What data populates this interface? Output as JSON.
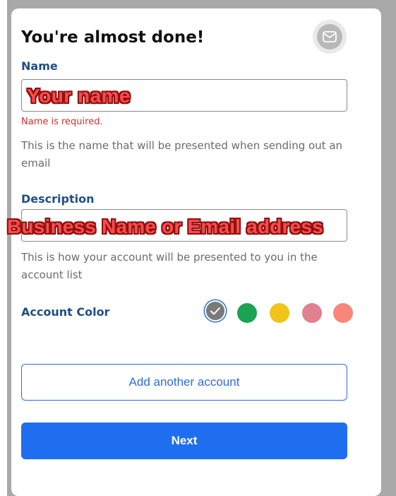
{
  "form": {
    "title": "You're almost done!",
    "badge_icon": "envelope-icon",
    "name": {
      "label": "Name",
      "value": "",
      "overlay_text": "Your name",
      "error": "Name is required.",
      "help": "This is the name that will be presented when sending out an email"
    },
    "description": {
      "label": "Description",
      "value": "",
      "overlay_text": "Business Name or Email address",
      "help": "This is how your account will be presented to you in the account list"
    },
    "account_color": {
      "label": "Account Color",
      "selected_index": 0,
      "options": [
        {
          "name": "gray",
          "color": "#7a7a7a"
        },
        {
          "name": "green",
          "color": "#1aa353"
        },
        {
          "name": "yellow",
          "color": "#f0c419"
        },
        {
          "name": "pink",
          "color": "#e08090"
        },
        {
          "name": "salmon",
          "color": "#f7877a"
        }
      ]
    },
    "add_account_label": "Add another account",
    "next_label": "Next"
  },
  "colors": {
    "label_blue": "#1f4e86",
    "accent_blue": "#1f6ef0",
    "error_red": "#d32f2f",
    "overlay_red": "#ff4b4b"
  }
}
